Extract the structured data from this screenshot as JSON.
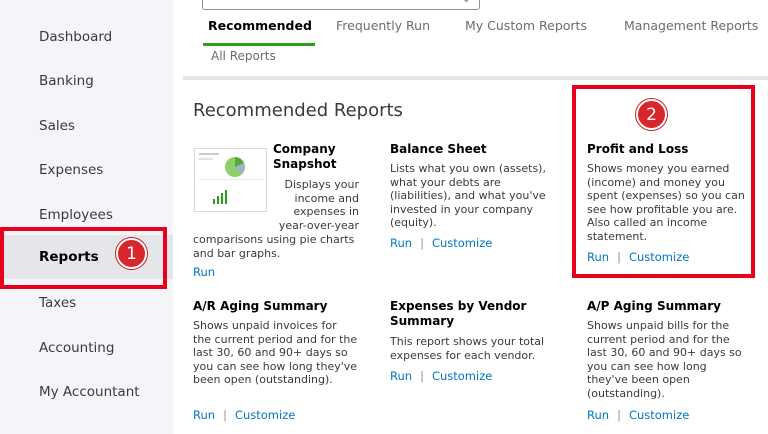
{
  "sidebar": {
    "items": [
      {
        "label": "Dashboard"
      },
      {
        "label": "Banking"
      },
      {
        "label": "Sales"
      },
      {
        "label": "Expenses"
      },
      {
        "label": "Employees"
      },
      {
        "label": "Reports"
      },
      {
        "label": "Taxes"
      },
      {
        "label": "Accounting"
      },
      {
        "label": "My Accountant"
      }
    ]
  },
  "badges": {
    "one": "1",
    "two": "2"
  },
  "tabs": {
    "items": [
      {
        "label": "Recommended"
      },
      {
        "label": "Frequently Run"
      },
      {
        "label": "My Custom Reports"
      },
      {
        "label": "Management Reports"
      }
    ],
    "all_reports": "All Reports"
  },
  "section_title": "Recommended Reports",
  "reports": {
    "company_snapshot": {
      "title_1": "Company",
      "title_2": "Snapshot",
      "desc_1": "Displays your",
      "desc_2": "income and",
      "desc_3": "expenses in",
      "desc_4": "year-over-year",
      "desc_5": "comparisons using pie charts",
      "desc_6": "and bar graphs.",
      "run": "Run"
    },
    "balance_sheet": {
      "title": "Balance Sheet",
      "desc": "Lists what you own (assets), what your debts are (liabilities), and what you've invested in your company (equity).",
      "run": "Run",
      "sep": "|",
      "customize": "Customize"
    },
    "profit_loss": {
      "title": "Profit and Loss",
      "desc": "Shows money you earned (income) and money you spent (expenses) so you can see how profitable you are. Also called an income statement.",
      "run": "Run",
      "sep": "|",
      "customize": "Customize"
    },
    "ar_aging": {
      "title": "A/R Aging Summary",
      "desc": "Shows unpaid invoices for the current period and for the last 30, 60 and 90+ days so you can see how long they've been open (outstanding).",
      "run": "Run",
      "sep": "|",
      "customize": "Customize"
    },
    "expenses_vendor": {
      "title": "Expenses by Vendor Summary",
      "desc": "This report shows your total expenses for each vendor.",
      "run": "Run",
      "sep": "|",
      "customize": "Customize"
    },
    "ap_aging": {
      "title": "A/P Aging Summary",
      "desc": "Shows unpaid bills for the current period and for the last 30, 60 and 90+ days so you can see how long they've been open (outstanding).",
      "run": "Run",
      "sep": "|",
      "customize": "Customize"
    }
  },
  "colors": {
    "highlight": "#e8001c",
    "link": "#0077c5",
    "tab_accent": "#2ca01c"
  }
}
